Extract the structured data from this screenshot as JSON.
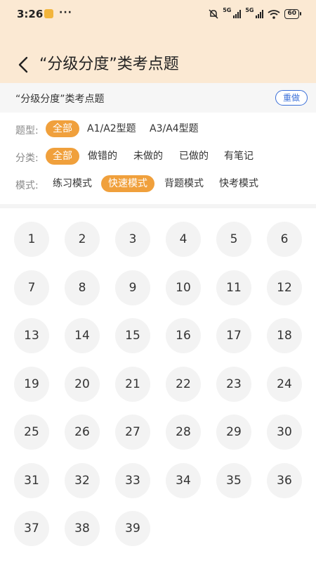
{
  "status_bar": {
    "time": "3:26",
    "dots": "···",
    "network_1": "5G",
    "network_2": "5G",
    "battery": "60"
  },
  "header": {
    "title": "“分级分度”类考点题"
  },
  "subbar": {
    "subtitle": "“分级分度”类考点题",
    "redo_label": "重做"
  },
  "filters": {
    "type": {
      "label": "题型:",
      "options": [
        "全部",
        "A1/A2型题",
        "A3/A4型题"
      ],
      "selected": 0
    },
    "category": {
      "label": "分类:",
      "options": [
        "全部",
        "做错的",
        "未做的",
        "已做的",
        "有笔记"
      ],
      "selected": 0
    },
    "mode": {
      "label": "模式:",
      "options": [
        "练习模式",
        "快速模式",
        "背题模式",
        "快考模式"
      ],
      "selected": 1
    }
  },
  "questions": [
    "1",
    "2",
    "3",
    "4",
    "5",
    "6",
    "7",
    "8",
    "9",
    "10",
    "11",
    "12",
    "13",
    "14",
    "15",
    "16",
    "17",
    "18",
    "19",
    "20",
    "21",
    "22",
    "23",
    "24",
    "25",
    "26",
    "27",
    "28",
    "29",
    "30",
    "31",
    "32",
    "33",
    "34",
    "35",
    "36",
    "37",
    "38",
    "39"
  ],
  "colors": {
    "header_bg": "#fbe9d3",
    "accent": "#f0a03c",
    "redo_border": "#3a6fd8"
  }
}
